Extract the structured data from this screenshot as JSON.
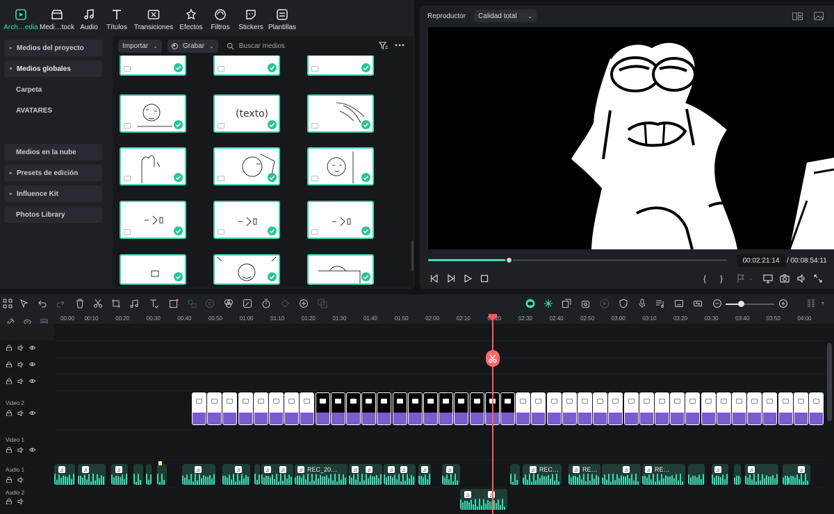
{
  "tabs": [
    {
      "label": "Arch…edia",
      "icon": "media-icon",
      "active": true
    },
    {
      "label": "Medi…tock",
      "icon": "stock-icon"
    },
    {
      "label": "Audio",
      "icon": "music-note-icon"
    },
    {
      "label": "Títulos",
      "icon": "text-t-icon"
    },
    {
      "label": "Transiciones",
      "icon": "transition-icon"
    },
    {
      "label": "Efectos",
      "icon": "effects-icon"
    },
    {
      "label": "Filtros",
      "icon": "filter-icon"
    },
    {
      "label": "Stickers",
      "icon": "sticker-icon"
    },
    {
      "label": "Plantillas",
      "icon": "template-icon"
    }
  ],
  "sidebar": {
    "items": [
      {
        "label": "Medios del proyecto",
        "caret": "▸"
      },
      {
        "label": "Medios globales",
        "caret": "▾"
      },
      {
        "label": "Carpeta",
        "caret": ""
      },
      {
        "label": "AVATARES",
        "caret": ""
      },
      {
        "label": "Medios en la nube",
        "caret": ""
      },
      {
        "label": "Presets de edición",
        "caret": "▸"
      },
      {
        "label": "Influence Kit",
        "caret": "▸"
      },
      {
        "label": "Photos Library",
        "caret": ""
      }
    ]
  },
  "media_toolbar": {
    "import_label": "Importar",
    "record_label": "Grabar",
    "search_placeholder": "Buscar medios"
  },
  "player": {
    "title": "Reproductor",
    "quality": "Calidad total",
    "time_current": "00:02:21:14",
    "time_total": "/ 00:08:54:11",
    "progress": 0.27
  },
  "ruler": {
    "labels": [
      "00:00",
      "00:10",
      "00:20",
      "00:30",
      "00:40",
      "00:50",
      "01:00",
      "01:10",
      "01:20",
      "01:30",
      "01:40",
      "01:50",
      "02:00",
      "02:10",
      "02:20",
      "02:30",
      "02:40",
      "02:50",
      "03:00",
      "03:10",
      "03:20",
      "03:30",
      "03:40",
      "03:50",
      "04:00"
    ]
  },
  "tracks": {
    "video2": "Video 2",
    "video1": "Video 1",
    "audio1": "Audio 1",
    "audio2": "Audio 2"
  },
  "audio_labels": {
    "a": "REC_20…",
    "b": "REC…",
    "c": "RE…",
    "d": "RE…"
  },
  "colors": {
    "accent": "#3fd9b4",
    "playhead": "#ff5b5b",
    "clip_purple": "#7b5ccf",
    "audio_green": "#3fd9b4"
  }
}
